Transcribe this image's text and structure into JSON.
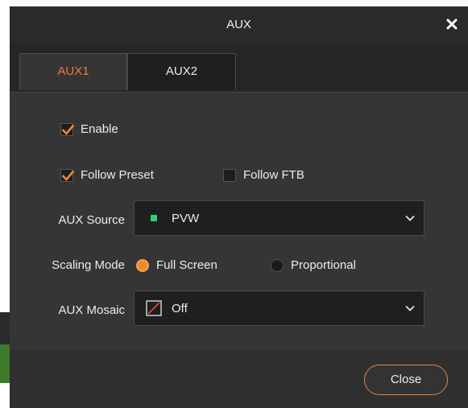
{
  "window": {
    "title": "AUX",
    "close_icon": "close-icon"
  },
  "tabs": [
    {
      "label": "AUX1",
      "active": true
    },
    {
      "label": "AUX2",
      "active": false
    }
  ],
  "settings": {
    "enable": {
      "label": "Enable",
      "checked": true
    },
    "follow_preset": {
      "label": "Follow Preset",
      "checked": true
    },
    "follow_ftb": {
      "label": "Follow FTB",
      "checked": false
    },
    "aux_source": {
      "label": "AUX Source",
      "value": "PVW",
      "indicator_color": "#2fd17a"
    },
    "scaling_mode": {
      "label": "Scaling Mode",
      "options": [
        {
          "label": "Full Screen",
          "selected": true
        },
        {
          "label": "Proportional",
          "selected": false
        }
      ]
    },
    "aux_mosaic": {
      "label": "AUX Mosaic",
      "value": "Off"
    }
  },
  "footer": {
    "close_label": "Close"
  },
  "colors": {
    "accent": "#f07a3a",
    "background": "#303030",
    "field": "#1f1f1f"
  }
}
